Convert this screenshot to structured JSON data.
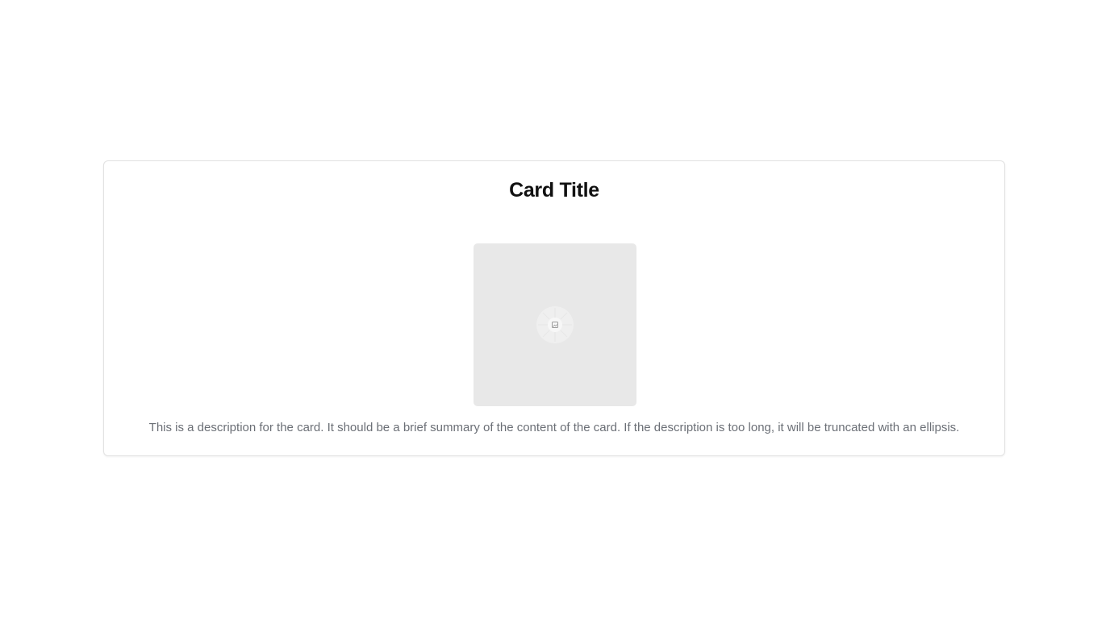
{
  "card": {
    "title": "Card Title",
    "image": {
      "icon": "image-icon"
    },
    "description": "This is a description for the card. It should be a brief summary of the content of the card. If the description is too long, it will be truncated with an ellipsis."
  }
}
